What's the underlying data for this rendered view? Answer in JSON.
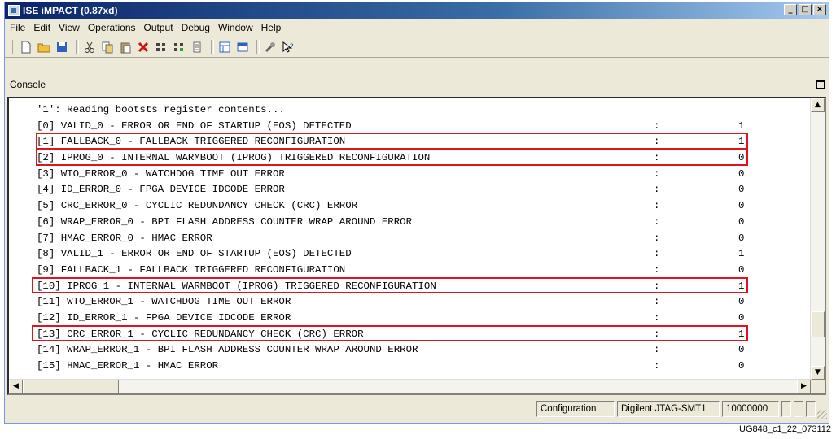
{
  "window": {
    "title": "ISE iMPACT (0.87xd)"
  },
  "menu": [
    "File",
    "Edit",
    "View",
    "Operations",
    "Output",
    "Debug",
    "Window",
    "Help"
  ],
  "toolbar_icons": [
    "new-file-icon",
    "open-folder-icon",
    "save-icon",
    "cut-icon",
    "copy-icon",
    "paste-icon",
    "delete-icon",
    "grid-icon",
    "grid-link-icon",
    "list-icon",
    "tree-icon",
    "window-icon",
    "wrench-icon",
    "help-pointer-icon"
  ],
  "console": {
    "label": "Console",
    "header_line": "'1': Reading bootsts register contents...",
    "rows": [
      {
        "text": "[0] VALID_0 - ERROR OR END OF STARTUP (EOS) DETECTED",
        "sep": ":",
        "value": "1"
      },
      {
        "text": "[1] FALLBACK_0 - FALLBACK TRIGGERED RECONFIGURATION",
        "sep": ":",
        "value": "1"
      },
      {
        "text": "[2] IPROG_0 - INTERNAL WARMBOOT (IPROG) TRIGGERED RECONFIGURATION",
        "sep": ":",
        "value": "0"
      },
      {
        "text": "[3] WTO_ERROR_0 - WATCHDOG TIME OUT ERROR",
        "sep": ":",
        "value": "0"
      },
      {
        "text": "[4] ID_ERROR_0 - FPGA DEVICE IDCODE ERROR",
        "sep": ":",
        "value": "0"
      },
      {
        "text": "[5] CRC_ERROR_0 - CYCLIC REDUNDANCY CHECK (CRC) ERROR",
        "sep": ":",
        "value": "0"
      },
      {
        "text": "[6] WRAP_ERROR_0 - BPI FLASH ADDRESS COUNTER WRAP AROUND ERROR",
        "sep": ":",
        "value": "0"
      },
      {
        "text": "[7] HMAC_ERROR_0 - HMAC ERROR",
        "sep": ":",
        "value": "0"
      },
      {
        "text": "[8] VALID_1 - ERROR OR END OF STARTUP (EOS) DETECTED",
        "sep": ":",
        "value": "1"
      },
      {
        "text": "[9] FALLBACK_1 - FALLBACK TRIGGERED RECONFIGURATION",
        "sep": ":",
        "value": "0"
      },
      {
        "text": "[10] IPROG_1 - INTERNAL WARMBOOT (IPROG) TRIGGERED RECONFIGURATION",
        "sep": ":",
        "value": "1"
      },
      {
        "text": "[11] WTO_ERROR_1 - WATCHDOG TIME OUT ERROR",
        "sep": ":",
        "value": "0"
      },
      {
        "text": "[12] ID_ERROR_1 - FPGA DEVICE IDCODE ERROR",
        "sep": ":",
        "value": "0"
      },
      {
        "text": "[13] CRC_ERROR_1 - CYCLIC REDUNDANCY CHECK (CRC) ERROR",
        "sep": ":",
        "value": "1"
      },
      {
        "text": "[14] WRAP_ERROR_1 - BPI FLASH ADDRESS COUNTER WRAP AROUND ERROR",
        "sep": ":",
        "value": "0"
      },
      {
        "text": "[15] HMAC_ERROR_1 - HMAC ERROR",
        "sep": ":",
        "value": "0"
      }
    ],
    "highlighted_rows": [
      1,
      2,
      10,
      13
    ],
    "highlight_color": "#e0141e"
  },
  "status": {
    "mode": "Configuration",
    "cable": "Digilent JTAG-SMT1",
    "speed": "10000000"
  },
  "caption": "UG848_c1_22_073112"
}
